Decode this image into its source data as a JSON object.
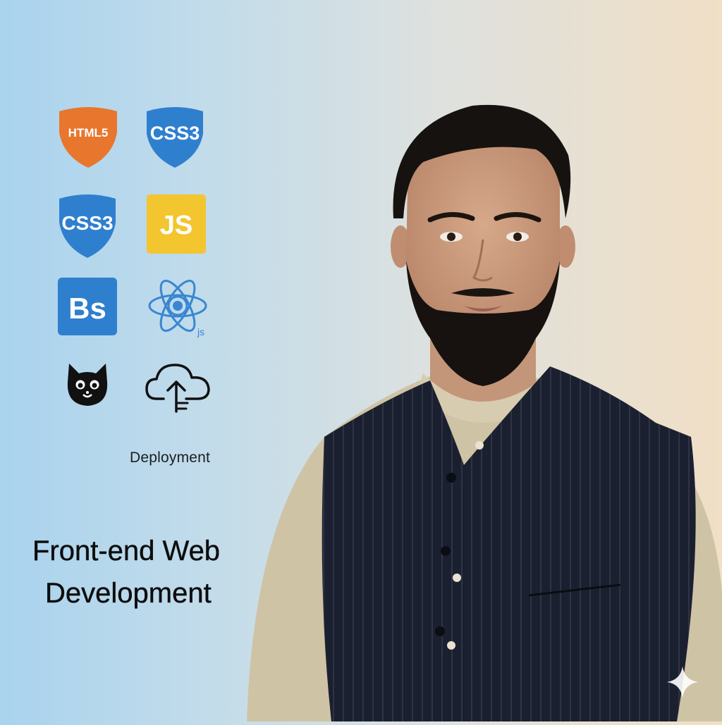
{
  "icons": {
    "html5": {
      "name": "html5-icon",
      "label": "HTML5",
      "color": "#e8762d"
    },
    "css3_a": {
      "name": "css3-icon",
      "label": "CSS3",
      "color": "#2f7fcf"
    },
    "css3_b": {
      "name": "css3-icon",
      "label": "CSS3",
      "color": "#2f7fcf"
    },
    "js": {
      "name": "javascript-icon",
      "label": "JS",
      "color": "#f3c52f"
    },
    "bootstrap": {
      "name": "bootstrap-icon",
      "label": "Bs",
      "color": "#2f7fcf"
    },
    "react": {
      "name": "react-icon",
      "label": "js",
      "color": "#3a86d1"
    },
    "cat": {
      "name": "github-cat-icon"
    },
    "cloud": {
      "name": "cloud-upload-icon"
    }
  },
  "deployment_label": "Deployment",
  "headline": {
    "line1": "Front-end Web",
    "line2": "Development"
  },
  "colors": {
    "vest": "#1b2030",
    "kurta": "#cfc3a5",
    "background_left": "#a9d3ee",
    "background_right": "#f1dfc6"
  }
}
